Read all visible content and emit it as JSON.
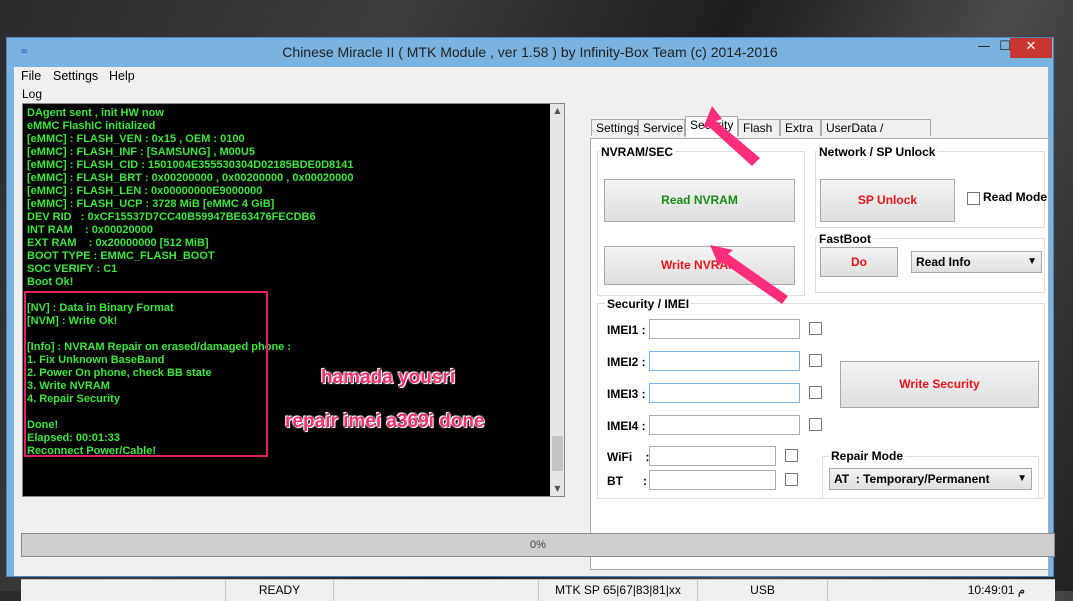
{
  "window": {
    "title": "Chinese Miracle II ( MTK Module , ver 1.58 ) by Infinity-Box Team (c) 2014-2016",
    "min_glyph": "—",
    "max_glyph": "☐",
    "close_glyph": "✕",
    "app_icon": "infinity-icon"
  },
  "menu": {
    "items": [
      "File",
      "Settings",
      "Help"
    ]
  },
  "log": {
    "label": "Log",
    "lines": [
      "DAgent sent , init HW now",
      "eMMC FlashIC initialized",
      "[eMMC] : FLASH_VEN : 0x15 , OEM : 0100",
      "[eMMC] : FLASH_INF : [SAMSUNG] , M00U5",
      "[eMMC] : FLASH_CID : 1501004E355530304D02185BDE0D8141",
      "[eMMC] : FLASH_BRT : 0x00200000 , 0x00200000 , 0x00020000",
      "[eMMC] : FLASH_LEN : 0x00000000E9000000",
      "[eMMC] : FLASH_UCP : 3728 MiB [eMMC 4 GiB]",
      "DEV RID   : 0xCF15537D7CC40B59947BE63476FECDB6",
      "INT RAM    : 0x00020000",
      "EXT RAM    : 0x20000000 [512 MiB]",
      "BOOT TYPE : EMMC_FLASH_BOOT",
      "SOC VERIFY : C1",
      "Boot Ok!",
      "",
      "[NV] : Data in Binary Format",
      "[NVM] : Write Ok!",
      "",
      "[Info] : NVRAM Repair on erased/damaged phone :",
      "1. Fix Unknown BaseBand",
      "2. Power On phone, check BB state",
      "3. Write NVRAM",
      "4. Repair Security",
      "",
      "Done!",
      "Elapsed: 00:01:33",
      "Reconnect Power/Cable!"
    ]
  },
  "overlay": {
    "line1": "hamada yousri",
    "line2": "repair imei a369i done",
    "color": "#ff2d6e"
  },
  "tabs": [
    "Settings",
    "Service",
    "Security",
    "Flash",
    "Extra",
    "UserData / Forensic"
  ],
  "active_tab": "Security",
  "nvram": {
    "label": "NVRAM/SEC",
    "read_btn": "Read NVRAM",
    "write_btn": "Write NVRAM"
  },
  "network": {
    "label": "Network / SP Unlock",
    "sp_btn": "SP Unlock",
    "read_mode": "Read Mode"
  },
  "fastboot": {
    "label": "FastBoot",
    "do_btn": "Do",
    "select_value": "Read Info"
  },
  "security": {
    "label": "Security / IMEI",
    "imei_labels": [
      "IMEI1 :",
      "IMEI2 :",
      "IMEI3 :",
      "IMEI4 :"
    ],
    "wifi_label": "WiFi    :",
    "bt_label": "BT      :",
    "write_btn": "Write Security"
  },
  "repair_mode": {
    "label": "Repair Mode",
    "value": "AT  : Temporary/Permanent"
  },
  "progress": {
    "text": "0%",
    "value": 0
  },
  "status": {
    "ready": "READY",
    "mtk": "MTK SP 65|67|83|81|xx",
    "usb": "USB",
    "time": "10:49:01 م"
  }
}
